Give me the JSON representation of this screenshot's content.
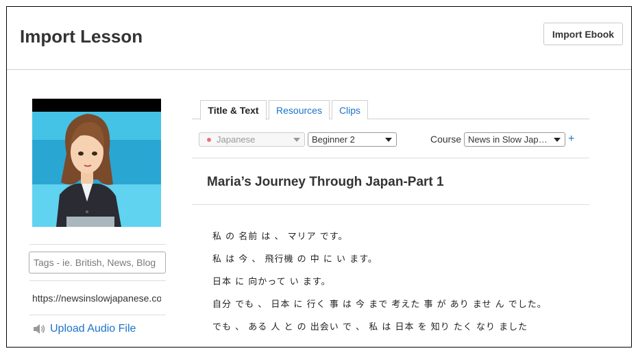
{
  "header": {
    "title": "Import Lesson",
    "import_ebook_label": "Import Ebook"
  },
  "sidebar": {
    "tags_placeholder": "Tags - ie. British, News, Blog",
    "url_value": "https://newsinslowjapanese.com",
    "upload_audio_label": "Upload Audio File"
  },
  "tabs": [
    {
      "label": "Title & Text",
      "active": true
    },
    {
      "label": "Resources",
      "active": false
    },
    {
      "label": "Clips",
      "active": false
    }
  ],
  "selectors": {
    "language": "Japanese",
    "level": "Beginner 2",
    "course_label": "Course",
    "course_value": "News in Slow Jap…",
    "course_add": "+"
  },
  "lesson": {
    "title": "Maria’s Journey Through Japan-Part 1",
    "lines": [
      "私 の 名前 は 、 マリア です。",
      "私 は 今 、 飛行機 の 中 に い ます。",
      "日本 に 向かって い ます。",
      "自分 でも 、 日本 に 行く 事 は 今 まで 考えた 事 が あり ませ ん でした。",
      "でも 、 ある 人 と の 出会い で 、 私 は 日本 を 知り たく なり ました"
    ]
  },
  "colors": {
    "link": "#1a73c8",
    "language_dot": "#e57373"
  }
}
